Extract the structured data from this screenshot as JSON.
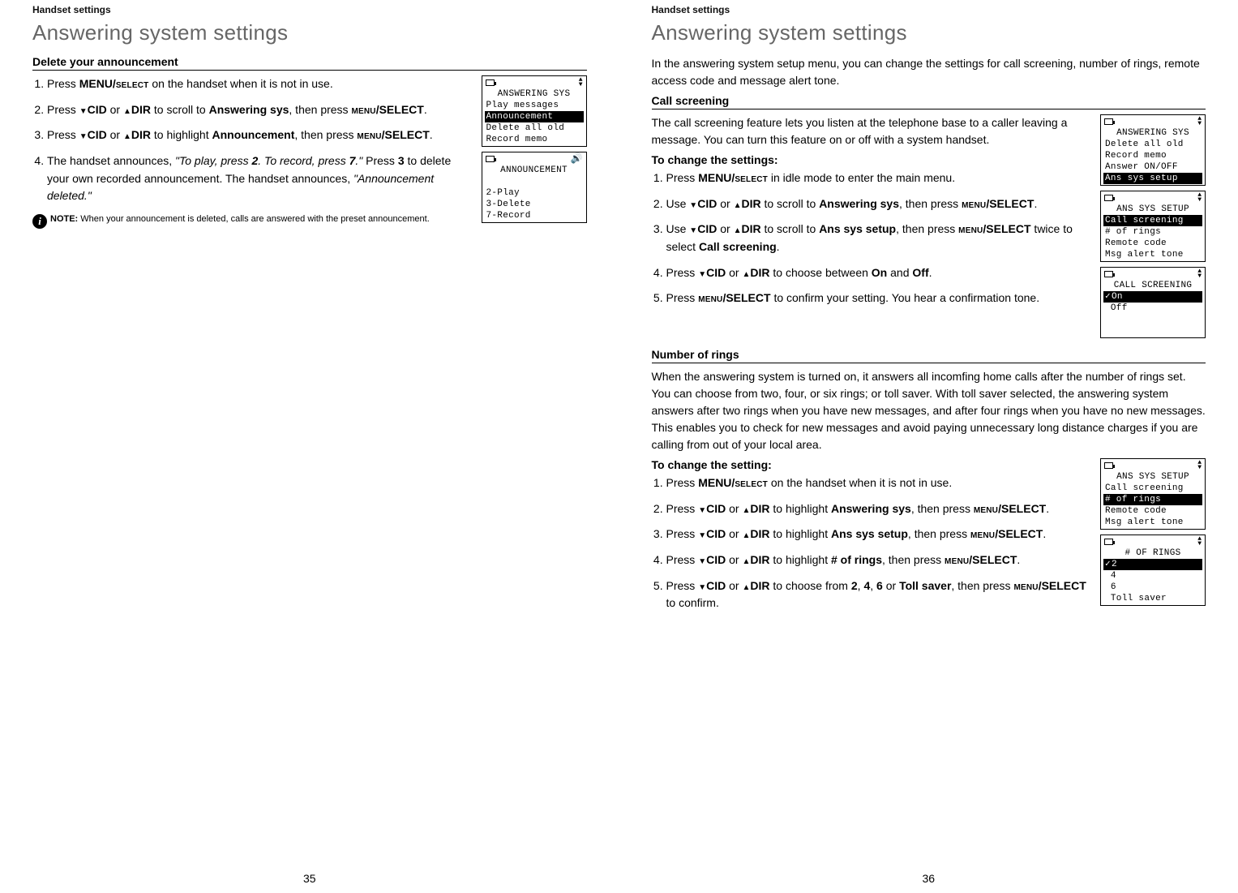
{
  "breadcrumb": "Handset settings",
  "page_title": "Answering system settings",
  "left": {
    "section": "Delete your announcement",
    "steps": [
      "Press MENU/SELECT on the handset when it is not in use.",
      "Press ▼CID or ▲DIR to scroll to Answering sys, then press MENU/SELECT.",
      "Press ▼CID or ▲DIR to highlight Announcement, then press MENU/SELECT.",
      "The handset announces, \"To play, press 2. To record, press 7.\" Press 3 to delete your own recorded announcement. The handset announces, \"Announcement deleted.\""
    ],
    "note_label": "NOTE:",
    "note": "When your announcement is deleted, calls are answered with the preset announcement.",
    "lcd1": {
      "title": "ANSWERING SYS",
      "l1": "Play messages",
      "l2": "Announcement",
      "l3": "Delete all old",
      "l4": "Record memo"
    },
    "lcd2": {
      "title": "ANNOUNCEMENT",
      "l1": "2-Play",
      "l2": "3-Delete",
      "l3": "7-Record"
    },
    "page_num": "35"
  },
  "right": {
    "intro": "In the answering system setup menu, you can change the settings for call screening, number of rings, remote access code and message alert tone.",
    "call_screening_heading": "Call screening",
    "call_screening_desc": "The call screening feature lets you listen at the telephone base to a caller leaving a message. You can turn this feature on or off with a system handset.",
    "to_change": "To change the settings:",
    "cs_steps": [
      "Press MENU/SELECT in idle mode to enter the main menu.",
      "Use ▼CID or ▲DIR to scroll to Answering sys, then press MENU/SELECT.",
      "Use ▼CID or ▲DIR to scroll to Ans sys setup, then press MENU/SELECT twice to select Call screening.",
      "Press ▼CID or ▲DIR to choose between On and Off.",
      "Press MENU/SELECT to confirm your setting. You hear a confirmation tone."
    ],
    "lcd_cs1": {
      "title": "ANSWERING SYS",
      "l1": "Delete all old",
      "l2": "Record memo",
      "l3": "Answer ON/OFF",
      "l4": "Ans sys setup"
    },
    "lcd_cs2": {
      "title": "ANS SYS SETUP",
      "l1": "Call screening",
      "l2": "# of rings",
      "l3": "Remote code",
      "l4": "Msg alert tone"
    },
    "lcd_cs3": {
      "title": "CALL SCREENING",
      "l1": "On",
      "l2": "Off"
    },
    "rings_heading": "Number of rings",
    "rings_desc": "When the answering system is turned on, it answers all incomfing home calls after the number of rings set. You can choose from two, four, or six rings; or toll saver. With toll saver selected, the answering system answers after two rings when you have new messages, and after four rings when you have no new messages. This enables you to check for new messages and avoid paying unnecessary long distance charges if you are calling from out of your local area.",
    "to_change2": "To change the setting:",
    "rings_steps": [
      "Press MENU/SELECT on the handset when it is not in use.",
      "Press ▼CID or ▲DIR to highlight Answering sys, then press MENU/SELECT.",
      "Press ▼CID or ▲DIR to highlight Ans sys setup, then press MENU/SELECT.",
      "Press ▼CID or ▲DIR to highlight # of rings, then press MENU/SELECT.",
      "Press ▼CID or ▲DIR to choose from 2, 4, 6 or Toll saver, then press MENU/SELECT to confirm."
    ],
    "lcd_r1": {
      "title": "ANS SYS SETUP",
      "l1": "Call screening",
      "l2": "# of rings",
      "l3": "Remote code",
      "l4": "Msg alert tone"
    },
    "lcd_r2": {
      "title": "# OF RINGS",
      "l1": "2",
      "l2": "4",
      "l3": "6",
      "l4": "Toll saver"
    },
    "page_num": "36"
  }
}
